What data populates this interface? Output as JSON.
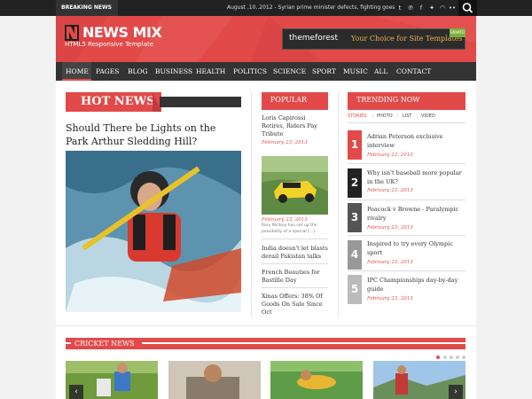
{
  "topbar": {
    "breaking_label": "BREAKING NEWS",
    "ticker_text": "August .10..2012 - Syrian prime minister defects, fighting goes on",
    "social_icons": [
      "twitter-icon",
      "pinterest-icon",
      "facebook-icon",
      "twitter-bird-icon",
      "rss-icon",
      "flickr-icon"
    ],
    "search_icon": "search-icon"
  },
  "header": {
    "logo_title": "NEWS MIX",
    "logo_subtitle": "HTML5 Responsive Template",
    "ad_brand": "themeforest",
    "ad_tagline": "Your Choice for Site Templates",
    "ad_ribbon": "ENVATO",
    "brand_color": "#e24a4a"
  },
  "nav": {
    "items": [
      "HOME",
      "PAGES",
      "BLOG",
      "BUSINESS",
      "HEALTH",
      "POLITICS",
      "SCIENCE",
      "SPORT",
      "MUSIC",
      "ALL",
      "CONTACT"
    ],
    "active": "HOME"
  },
  "hot_news": {
    "label": "HOT NEWS",
    "headline": "Should There be Lights on the Park Arthur Sledding Hill?"
  },
  "popular": {
    "label": "POPULAR",
    "top_title": "Loris Capirossi Retires, Riders Pay Tribute",
    "top_date": "February 23, 2013",
    "second_date": "February 23, 2013",
    "caption": "Rory McIlroy has set up the possibility of a special [...]",
    "items": [
      "India doesn't let blasts derail Pakistan talks",
      "French Beauties for Bastille Day",
      "Xmas Offers: 38% Of Goods On Sale Since Oct"
    ]
  },
  "trending": {
    "label": "TRENDING NOW",
    "tabs": [
      "STORIES",
      "PHOTO",
      "LIST",
      "VIDEO"
    ],
    "active_tab": "STORIES",
    "items": [
      {
        "num": "1",
        "title": "Adrian Peterson exclusive interview",
        "date": "February 23, 2013",
        "color": "#e24a4a"
      },
      {
        "num": "2",
        "title": "Why isn't baseball more popular in the UK?",
        "date": "February 23, 2013",
        "color": "#222222"
      },
      {
        "num": "3",
        "title": "Peacock v Browne - Paralympic rivalry",
        "date": "February 23, 2013",
        "color": "#555555"
      },
      {
        "num": "4",
        "title": "Inspired to try every Olympic sport",
        "date": "February 23, 2013",
        "color": "#999999"
      },
      {
        "num": "5",
        "title": "IPC Championships day-by-day guide",
        "date": "February 23, 2013",
        "color": "#bbbbbb"
      }
    ]
  },
  "cricket": {
    "label": "CRICKET NEWS",
    "prev_icon": "chevron-left-icon",
    "next_icon": "chevron-right-icon"
  }
}
